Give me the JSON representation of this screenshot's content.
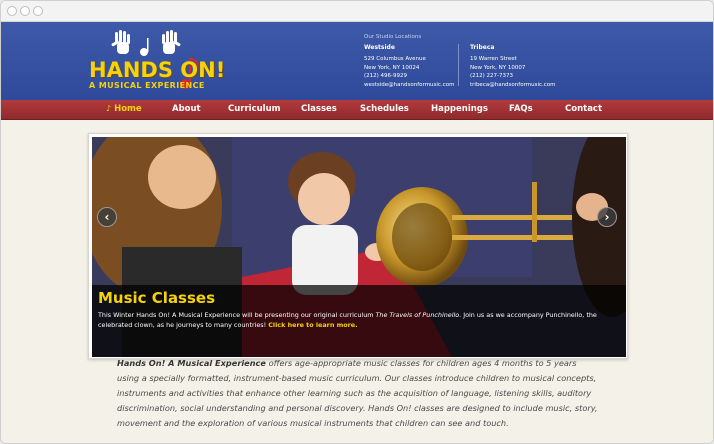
{
  "site": {
    "logo_text": "HANDS ON!",
    "logo_subtitle": "A MUSICAL EXPERIENCE"
  },
  "header": {
    "locations_heading": "Our Studio Locations",
    "locations": [
      {
        "name": "Westside",
        "address_line1": "529 Columbus Avenue",
        "address_line2": "New York, NY 10024",
        "phone": "(212) 496-9929",
        "email": "westside@handsonformusic.com"
      },
      {
        "name": "Tribeca",
        "address_line1": "19 Warren Street",
        "address_line2": "New York, NY 10007",
        "phone": "(212) 227-7373",
        "email": "tribeca@handsonformusic.com"
      }
    ]
  },
  "nav": {
    "items": [
      {
        "label": "Home",
        "icon": "music-note-icon"
      },
      {
        "label": "About"
      },
      {
        "label": "Curriculum"
      },
      {
        "label": "Classes"
      },
      {
        "label": "Schedules"
      },
      {
        "label": "Happenings"
      },
      {
        "label": "FAQs"
      },
      {
        "label": "Contact"
      }
    ]
  },
  "slider": {
    "caption_title": "Music Classes",
    "caption_text_before": "This Winter Hands On! A Musical Experience will be presenting our original curriculum ",
    "caption_text_title": "The Travels of Punchinello",
    "caption_text_after": ". Join us as we accompany Punchinello, the celebrated clown, as he journeys to many countries! ",
    "caption_link": "Click here to learn more."
  },
  "intro": {
    "brand": "Hands On! A Musical Experience",
    "text": " offers age-appropriate music classes for children ages 4 months to 5 years using a specially formatted, instrument-based music curriculum. Our classes introduce children to musical concepts, instruments and activities that enhance other learning such as the acquisition of language, listening skills, auditory discrimination, social understanding and personal discovery. Hands On! classes are designed to include music, story, movement and the exploration of various musical instruments that children can see and touch."
  },
  "colors": {
    "header_blue": "#3d59a8",
    "nav_red": "#b33a3c",
    "accent_yellow": "#f6d20b",
    "page_bg": "#f4f2e8"
  }
}
